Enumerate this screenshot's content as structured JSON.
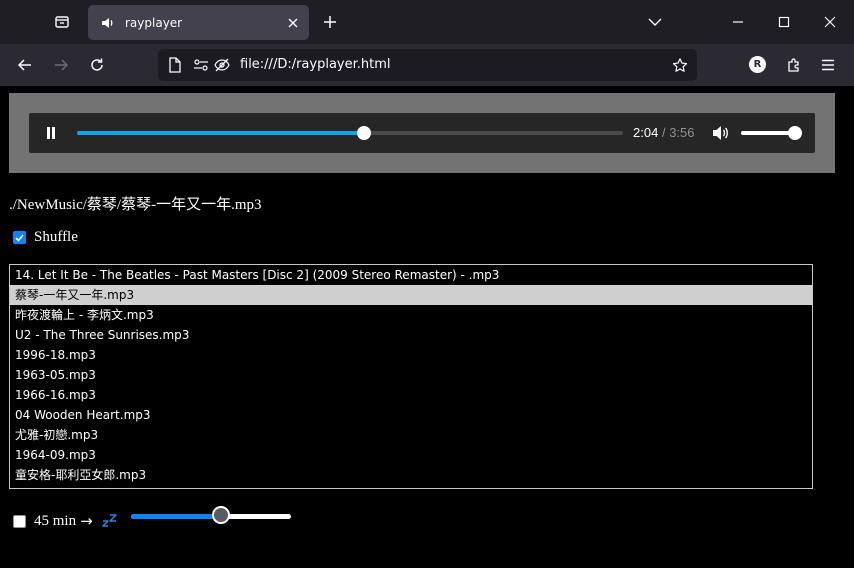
{
  "browser": {
    "tab_title": "rayplayer",
    "url": "file:///D:/rayplayer.html",
    "account_initial": "R"
  },
  "player": {
    "current_time": "2:04",
    "separator": "/",
    "duration": "3:56",
    "progress_fraction": 0.525,
    "volume_fraction": 1.0,
    "accent_color": "#0ea5e9"
  },
  "now_playing_path": "./NewMusic/蔡琴/蔡琴-一年又一年.mp3",
  "shuffle": {
    "label": "Shuffle",
    "checked": true
  },
  "playlist": {
    "items": [
      "14. Let It Be - The Beatles - Past Masters [Disc 2] (2009 Stereo Remaster) - .mp3",
      "蔡琴-一年又一年.mp3",
      "昨夜渡輪上 - 李炳文.mp3",
      "U2 - The Three Sunrises.mp3",
      "1996-18.mp3",
      "1963-05.mp3",
      "1966-16.mp3",
      "04 Wooden Heart.mp3",
      "尤雅-初戀.mp3",
      "1964-09.mp3",
      "童安格-耶利亞女郎.mp3"
    ],
    "selected_index": 1
  },
  "sleep_timer": {
    "label": "45 min",
    "arrow": "→",
    "checked": false,
    "slider_fraction": 0.56,
    "icon": "zzz-icon"
  }
}
